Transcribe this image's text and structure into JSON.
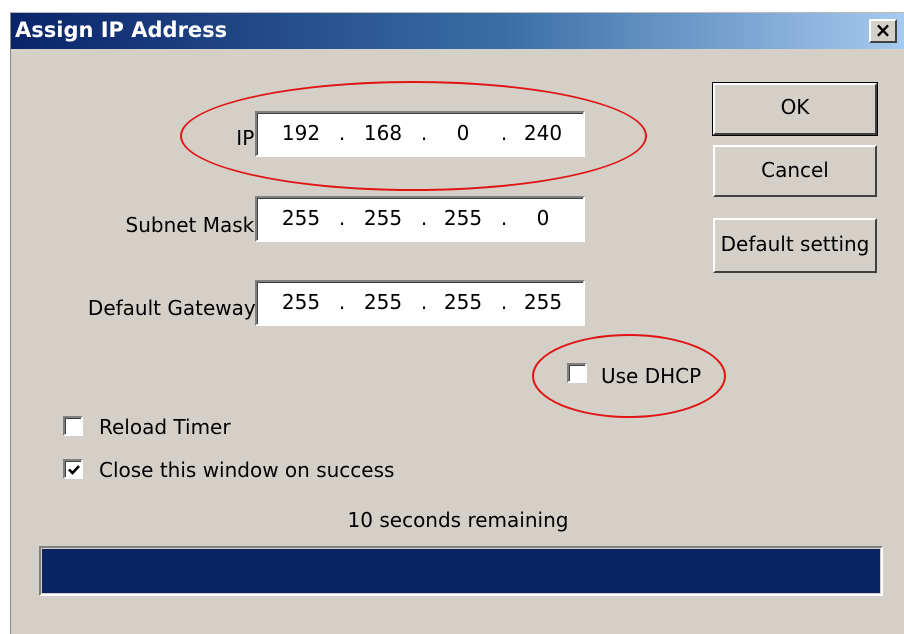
{
  "window": {
    "title": "Assign IP Address",
    "close_glyph": "✕"
  },
  "fields": {
    "ip": {
      "label": "IP:",
      "octets": [
        "192",
        "168",
        "0",
        "240"
      ]
    },
    "subnet": {
      "label": "Subnet Mask:",
      "octets": [
        "255",
        "255",
        "255",
        "0"
      ]
    },
    "gateway": {
      "label": "Default Gateway:",
      "octets": [
        "255",
        "255",
        "255",
        "255"
      ]
    },
    "separator": "."
  },
  "buttons": {
    "ok": "OK",
    "cancel": "Cancel",
    "default_setting": "Default setting"
  },
  "checkboxes": {
    "use_dhcp": {
      "label": "Use DHCP",
      "checked": false
    },
    "reload_timer": {
      "label": "Reload Timer",
      "checked": false
    },
    "close_on_success": {
      "label": "Close this window on success",
      "checked": true
    }
  },
  "status": {
    "remaining_text": "10 seconds remaining",
    "progress": 1.0
  },
  "colors": {
    "annotation_ring": "#e01414",
    "progress_fill": "#0a2461",
    "titlebar_start": "#0a246a"
  }
}
